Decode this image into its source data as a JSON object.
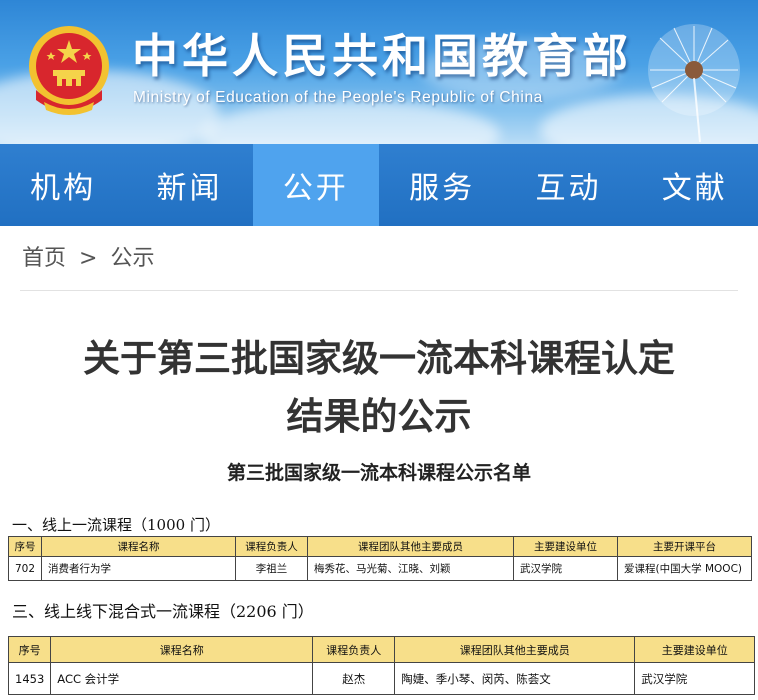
{
  "header": {
    "title": "中华人民共和国教育部",
    "subtitle": "Ministry of Education of the People's Republic of China"
  },
  "nav": {
    "items": [
      {
        "label": "机构"
      },
      {
        "label": "新闻"
      },
      {
        "label": "公开"
      },
      {
        "label": "服务"
      },
      {
        "label": "互动"
      },
      {
        "label": "文献"
      }
    ],
    "active": "公开"
  },
  "breadcrumb": {
    "home": "首页",
    "separator": ">",
    "current": "公示"
  },
  "article": {
    "title_line1": "关于第三批国家级一流本科课程认定",
    "title_line2": "结果的公示",
    "doc_heading": "第三批国家级一流本科课程公示名单"
  },
  "section1": {
    "title": "一、线上一流课程（1000 门）",
    "headers": [
      "序号",
      "课程名称",
      "课程负责人",
      "课程团队其他主要成员",
      "主要建设单位",
      "主要开课平台"
    ],
    "rows": [
      [
        "702",
        "消费者行为学",
        "李祖兰",
        "梅秀花、马光菊、江晓、刘颖",
        "武汉学院",
        "爱课程(中国大学 MOOC)"
      ]
    ]
  },
  "section2": {
    "title": "三、线上线下混合式一流课程（2206 门）",
    "headers": [
      "序号",
      "课程名称",
      "课程负责人",
      "课程团队其他主要成员",
      "主要建设单位"
    ],
    "rows": [
      [
        "1453",
        "ACC 会计学",
        "赵杰",
        "陶婕、季小琴、闵芮、陈荟文",
        "武汉学院"
      ]
    ]
  },
  "colors": {
    "nav_bg": "#2170c2",
    "nav_active": "#4fa3ee",
    "table_header_bg": "#f7df8a"
  }
}
